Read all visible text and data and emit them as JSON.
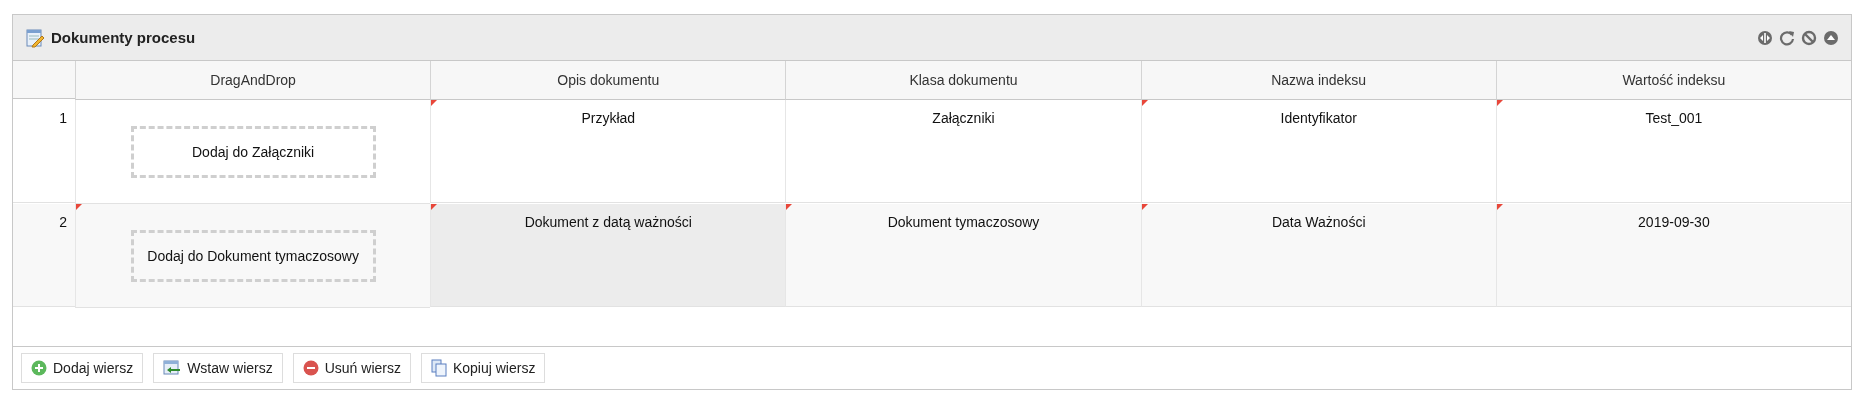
{
  "panel": {
    "title": "Dokumenty procesu"
  },
  "table": {
    "columns": [
      "DragAndDrop",
      "Opis dokumentu",
      "Klasa dokumentu",
      "Nazwa indeksu",
      "Wartość indeksu"
    ],
    "rows": [
      {
        "number": "1",
        "cells": [
          {
            "kind": "drop",
            "text": "Dodaj do Załączniki",
            "modified": false,
            "selected": false
          },
          {
            "kind": "text",
            "text": "Przykład",
            "modified": true,
            "selected": false
          },
          {
            "kind": "text",
            "text": "Załączniki",
            "modified": false,
            "selected": false
          },
          {
            "kind": "text",
            "text": "Identyfikator",
            "modified": true,
            "selected": false
          },
          {
            "kind": "text",
            "text": "Test_001",
            "modified": true,
            "selected": false
          }
        ]
      },
      {
        "number": "2",
        "cells": [
          {
            "kind": "drop",
            "text": "Dodaj do Dokument tymaczosowy",
            "modified": true,
            "selected": false
          },
          {
            "kind": "text",
            "text": "Dokument z datą ważności",
            "modified": true,
            "selected": true
          },
          {
            "kind": "text",
            "text": "Dokument tymaczosowy",
            "modified": true,
            "selected": false
          },
          {
            "kind": "text",
            "text": "Data Ważności",
            "modified": true,
            "selected": false
          },
          {
            "kind": "text",
            "text": "2019-09-30",
            "modified": true,
            "selected": false
          }
        ]
      }
    ]
  },
  "buttons": [
    {
      "label": "Dodaj wiersz",
      "kind": "add"
    },
    {
      "label": "Wstaw wiersz",
      "kind": "insert"
    },
    {
      "label": "Usuń wiersz",
      "kind": "remove"
    },
    {
      "label": "Kopiuj wiersz",
      "kind": "copy"
    }
  ]
}
